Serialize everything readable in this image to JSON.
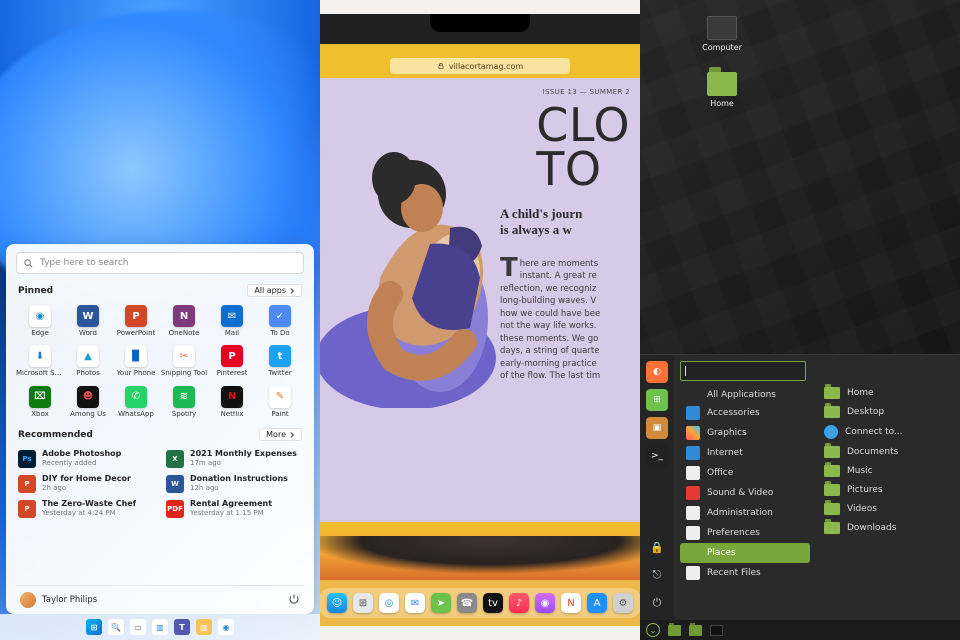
{
  "windows": {
    "search_placeholder": "Type here to search",
    "pinned_title": "Pinned",
    "all_apps_label": "All apps",
    "recommended_title": "Recommended",
    "more_label": "More",
    "user": "Taylor Philips",
    "pinned": [
      {
        "label": "Edge",
        "bg": "#ffffff",
        "glyph": "◉",
        "fg": "#1e88d2"
      },
      {
        "label": "Word",
        "bg": "#2b579a",
        "glyph": "W"
      },
      {
        "label": "PowerPoint",
        "bg": "#d24726",
        "glyph": "P"
      },
      {
        "label": "OneNote",
        "bg": "#80397b",
        "glyph": "N"
      },
      {
        "label": "Mail",
        "bg": "#0f6ecd",
        "glyph": "✉",
        "fg": "#fff"
      },
      {
        "label": "To Do",
        "bg": "#4e8af4",
        "glyph": "✓"
      },
      {
        "label": "Microsoft Store",
        "bg": "#ffffff",
        "glyph": "⬇",
        "fg": "#277ad1"
      },
      {
        "label": "Photos",
        "bg": "#ffffff",
        "glyph": "▲",
        "fg": "#1f9ed1"
      },
      {
        "label": "Your Phone",
        "bg": "#ffffff",
        "glyph": "▉",
        "fg": "#0b62c9"
      },
      {
        "label": "Snipping Tool",
        "bg": "#ffffff",
        "glyph": "✂",
        "fg": "#e8693f"
      },
      {
        "label": "Pinterest",
        "bg": "#e60023",
        "glyph": "P"
      },
      {
        "label": "Twitter",
        "bg": "#1da1f2",
        "glyph": "t"
      },
      {
        "label": "Xbox",
        "bg": "#107c10",
        "glyph": "⌧"
      },
      {
        "label": "Among Us",
        "bg": "#111",
        "glyph": "☻",
        "fg": "#d94c4c"
      },
      {
        "label": "WhatsApp",
        "bg": "#25d366",
        "glyph": "✆"
      },
      {
        "label": "Spotify",
        "bg": "#1db954",
        "glyph": "≋"
      },
      {
        "label": "Netflix",
        "bg": "#111",
        "glyph": "N",
        "fg": "#e50914"
      },
      {
        "label": "Paint",
        "bg": "#ffffff",
        "glyph": "✎",
        "fg": "#e07b2e"
      }
    ],
    "recommended": [
      {
        "title": "Adobe Photoshop",
        "sub": "Recently added",
        "bg": "#001d34",
        "glyph": "Ps",
        "fg": "#31a8ff"
      },
      {
        "title": "2021 Monthly Expenses",
        "sub": "17m ago",
        "bg": "#217346",
        "glyph": "X"
      },
      {
        "title": "DIY for Home Decor",
        "sub": "2h ago",
        "bg": "#d24726",
        "glyph": "P"
      },
      {
        "title": "Donation Instructions",
        "sub": "12h ago",
        "bg": "#2b579a",
        "glyph": "W"
      },
      {
        "title": "The Zero-Waste Chef",
        "sub": "Yesterday at 4:24 PM",
        "bg": "#d24726",
        "glyph": "P"
      },
      {
        "title": "Rental Agreement",
        "sub": "Yesterday at 1:15 PM",
        "bg": "#e2231a",
        "glyph": "PDF"
      }
    ]
  },
  "mac": {
    "url": "villacortamag.com",
    "issue": "ISSUE 13 — SUMMER 2",
    "headline_l1": "CLO",
    "headline_l2": "TO",
    "subhead": "A child's journ\nis always a w",
    "body": "here are moments\ninstant. A great re\nreflection, we recogniz\nlong-building waves. V\nhow we could have bee\nnot the way life works.\nthese moments. We go\ndays, a string of quarte\nearly-morning practice\nof the flow. The last tim",
    "dock": [
      {
        "name": "finder",
        "bg": "linear-gradient(#29c0ff,#1488e6)",
        "glyph": "☺"
      },
      {
        "name": "launchpad",
        "bg": "#e8e8e8",
        "glyph": "⊞",
        "fg": "#555"
      },
      {
        "name": "safari",
        "bg": "#fff",
        "glyph": "◎",
        "fg": "#1e88d2"
      },
      {
        "name": "mail",
        "bg": "#fff",
        "glyph": "✉",
        "fg": "#2b87f3"
      },
      {
        "name": "maps",
        "bg": "#6cc24a",
        "glyph": "➤"
      },
      {
        "name": "contacts",
        "bg": "#8a8a8a",
        "glyph": "☎"
      },
      {
        "name": "appletv",
        "bg": "#111",
        "glyph": "tv",
        "fg": "#fff"
      },
      {
        "name": "music",
        "bg": "linear-gradient(#ff5a6b,#ff2d55)",
        "glyph": "♪"
      },
      {
        "name": "podcasts",
        "bg": "linear-gradient(#d36bff,#9b4dff)",
        "glyph": "◉"
      },
      {
        "name": "news",
        "bg": "#fff",
        "glyph": "N",
        "fg": "#ff3b30"
      },
      {
        "name": "appstore",
        "bg": "#1e90ff",
        "glyph": "A"
      },
      {
        "name": "settings",
        "bg": "#d0d0d0",
        "glyph": "⚙",
        "fg": "#555"
      }
    ]
  },
  "mint": {
    "desktop": {
      "computer": "Computer",
      "home": "Home"
    },
    "all_apps": "All Applications",
    "categories": [
      {
        "label": "Accessories",
        "bg": "#2e8bd8"
      },
      {
        "label": "Graphics",
        "bg": "linear-gradient(45deg,#ff5277,#ffa532,#3bc0ff)"
      },
      {
        "label": "Internet",
        "bg": "#2e8bd8"
      },
      {
        "label": "Office",
        "bg": "#eeeeee"
      },
      {
        "label": "Sound & Video",
        "bg": "#e53935"
      },
      {
        "label": "Administration",
        "bg": "#eeeeee"
      },
      {
        "label": "Preferences",
        "bg": "#eeeeee"
      },
      {
        "label": "Places",
        "bg": "#79a63b",
        "active": true
      },
      {
        "label": "Recent Files",
        "bg": "#eeeeee"
      }
    ],
    "places": [
      "Home",
      "Desktop",
      "Connect to...",
      "Documents",
      "Music",
      "Pictures",
      "Videos",
      "Downloads"
    ],
    "rail": [
      {
        "name": "firefox",
        "bg": "#ff7139",
        "glyph": "◐"
      },
      {
        "name": "software",
        "bg": "#6cc24a",
        "glyph": "⊞"
      },
      {
        "name": "files",
        "bg": "#d08a3a",
        "glyph": "▣"
      },
      {
        "name": "terminal",
        "bg": "#222",
        "glyph": ">_"
      }
    ],
    "rail_bottom": [
      {
        "name": "lock",
        "glyph": "🔒"
      },
      {
        "name": "logout",
        "glyph": "⎋"
      },
      {
        "name": "power",
        "glyph": "⏻"
      }
    ]
  }
}
